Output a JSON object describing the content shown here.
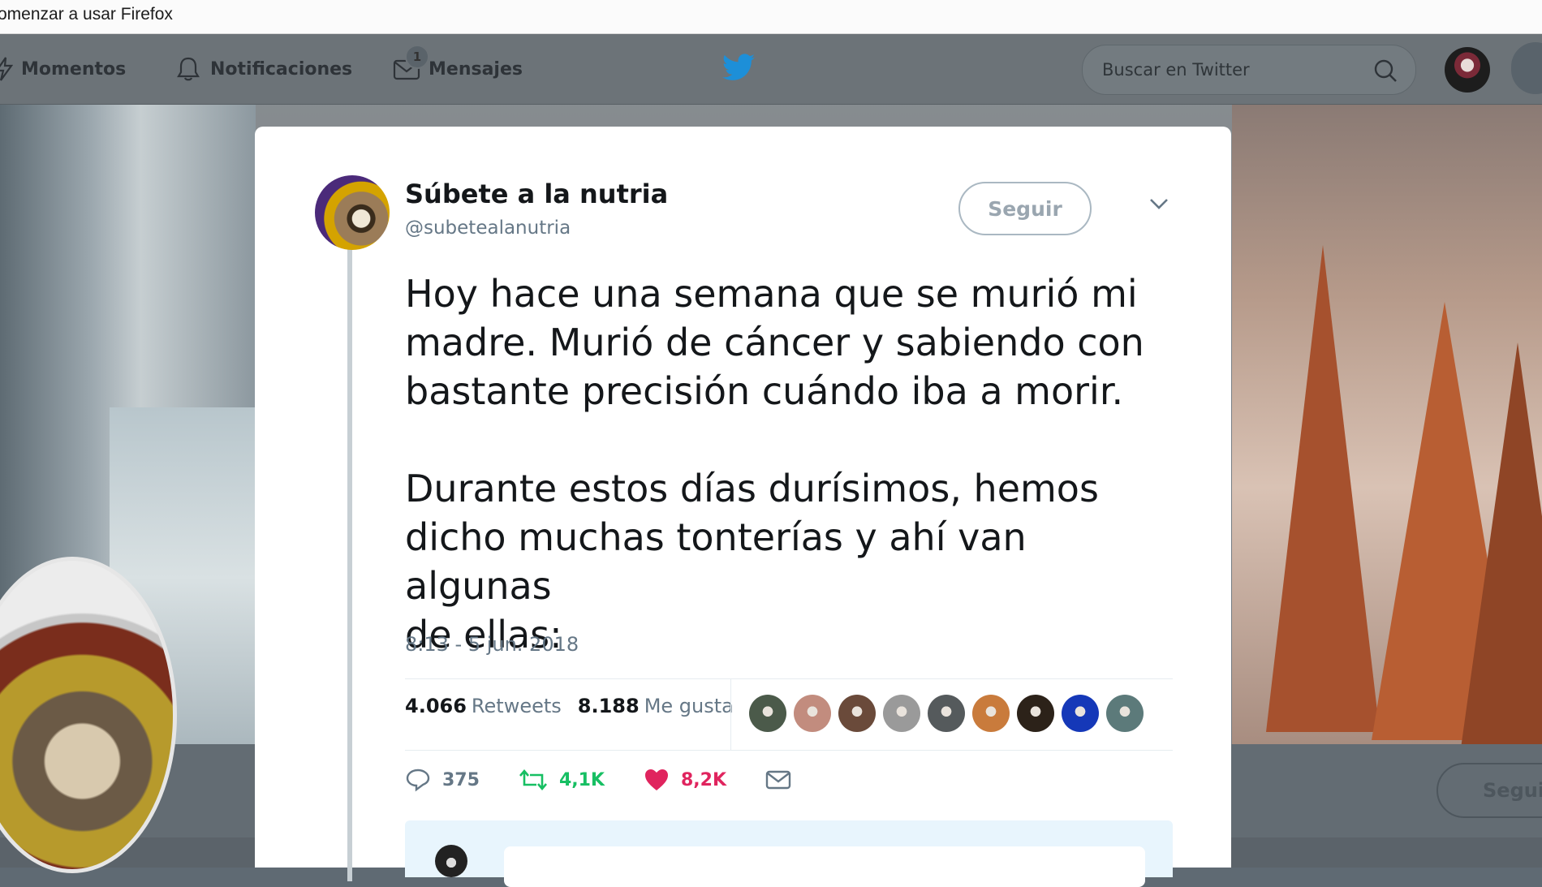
{
  "browser": {
    "title": "omenzar a usar Firefox"
  },
  "nav": {
    "moments": "Momentos",
    "notifications": "Notificaciones",
    "messages": "Mensajes",
    "messages_badge": "1",
    "search_placeholder": "Buscar en Twitter"
  },
  "background": {
    "follow_label": "Seguir"
  },
  "tweet": {
    "author_name": "Súbete a la nutria",
    "author_handle": "@subetealanutria",
    "follow_label": "Seguir",
    "text": "Hoy hace una semana que se murió mi\nmadre. Murió de cáncer y sabiendo con\nbastante precisión cuándo iba a morir.\n\nDurante estos días durísimos, hemos\ndicho muchas tonterías y ahí van algunas\nde ellas:",
    "timestamp": "8:13 - 5 jun. 2018",
    "retweets_count": "4.066",
    "retweets_label": "Retweets",
    "likes_count": "8.188",
    "likes_label": "Me gusta",
    "reply_count": "375",
    "retweet_action_count": "4,1K",
    "like_action_count": "8,2K"
  },
  "colors": {
    "retweet_green": "#17bf63",
    "like_red": "#e0245e",
    "twitter_blue": "#1da1f2",
    "muted_text": "#657786"
  },
  "likers": [
    "#4b5a4a",
    "#c28c7e",
    "#6a4a3a",
    "#9a9a9a",
    "#555a5c",
    "#c97b3c",
    "#2c2219",
    "#1538b8",
    "#5c7a7a"
  ]
}
